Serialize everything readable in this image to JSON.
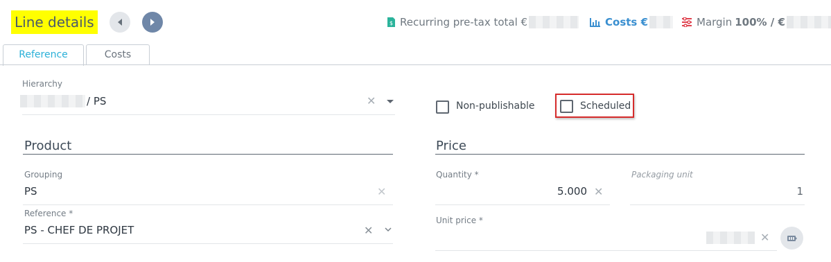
{
  "header": {
    "title": "Line details",
    "recurring_label": "Recurring pre-tax total €",
    "costs_label": "Costs €",
    "margin_prefix": "Margin ",
    "margin_value": "100% / €"
  },
  "tabs": [
    {
      "label": "Reference",
      "active": true
    },
    {
      "label": "Costs",
      "active": false
    }
  ],
  "hierarchy": {
    "label": "Hierarchy",
    "value": "/ PS"
  },
  "checkboxes": {
    "non_publishable": {
      "label": "Non-publishable",
      "checked": false
    },
    "scheduled": {
      "label": "Scheduled",
      "checked": false
    }
  },
  "product": {
    "heading": "Product",
    "grouping": {
      "label": "Grouping",
      "value": "PS"
    },
    "reference": {
      "label": "Reference *",
      "value": "PS - CHEF DE PROJET"
    }
  },
  "price": {
    "heading": "Price",
    "quantity": {
      "label": "Quantity *",
      "value": "5.000"
    },
    "packaging": {
      "label": "Packaging unit",
      "value": "1"
    },
    "unit_price": {
      "label": "Unit price *"
    }
  },
  "colors": {
    "accent": "#2ab0d8",
    "highlight": "#ffff00",
    "green": "#2bb39b",
    "blue": "#3a8fd0",
    "red": "#e0424f",
    "annotation": "#d62b2b"
  },
  "icons": [
    "arrow-left-icon",
    "arrow-right-icon",
    "invoice-icon",
    "bar-chart-icon",
    "sliders-icon",
    "close-icon",
    "caret-down-icon",
    "chevron-down-icon",
    "calculator-icon"
  ]
}
